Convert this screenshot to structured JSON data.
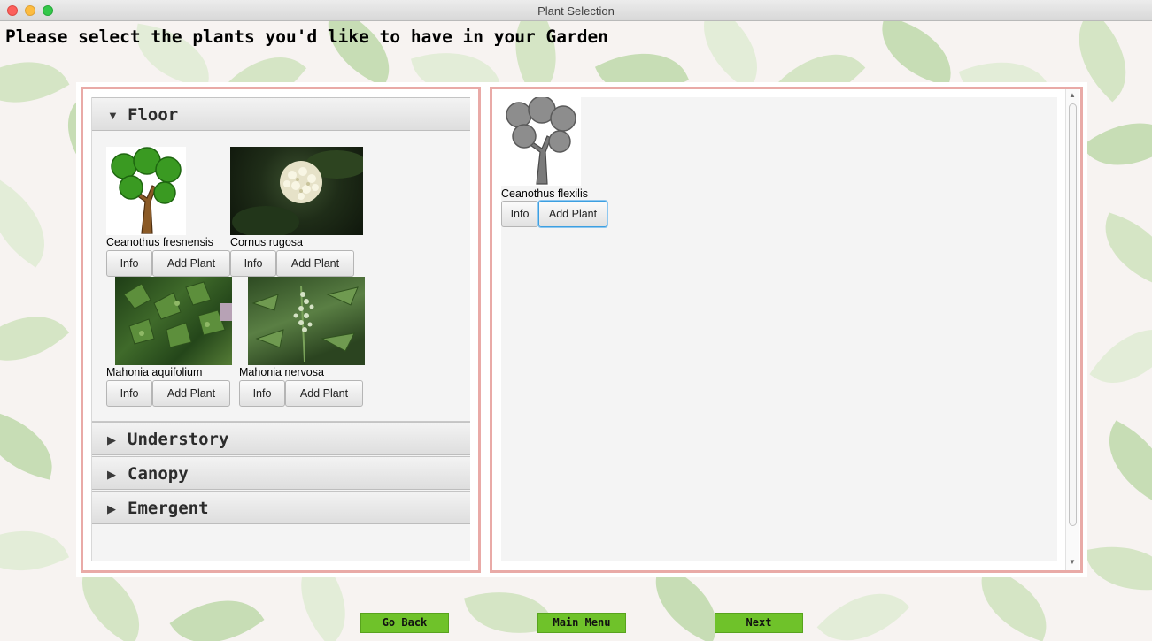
{
  "window": {
    "title": "Plant Selection"
  },
  "heading": "Please select the plants you'd like to have in your Garden",
  "accordion": {
    "floor": {
      "label": "Floor",
      "plants": [
        {
          "name": "Ceanothus fresnensis",
          "info_label": "Info",
          "add_label": "Add Plant"
        },
        {
          "name": "Cornus rugosa",
          "info_label": "Info",
          "add_label": "Add Plant"
        },
        {
          "name": "Mahonia aquifolium",
          "info_label": "Info",
          "add_label": "Add Plant"
        },
        {
          "name": "Mahonia nervosa",
          "info_label": "Info",
          "add_label": "Add Plant"
        }
      ]
    },
    "understory": {
      "label": "Understory"
    },
    "canopy": {
      "label": "Canopy"
    },
    "emergent": {
      "label": "Emergent"
    }
  },
  "selection": {
    "plants": [
      {
        "name": "Ceanothus flexilis",
        "info_label": "Info",
        "add_label": "Add Plant"
      }
    ]
  },
  "nav": {
    "back": "Go Back",
    "menu": "Main Menu",
    "next": "Next"
  },
  "colors": {
    "pane_border": "#e9aaa7",
    "nav_button": "#6fc22a"
  }
}
